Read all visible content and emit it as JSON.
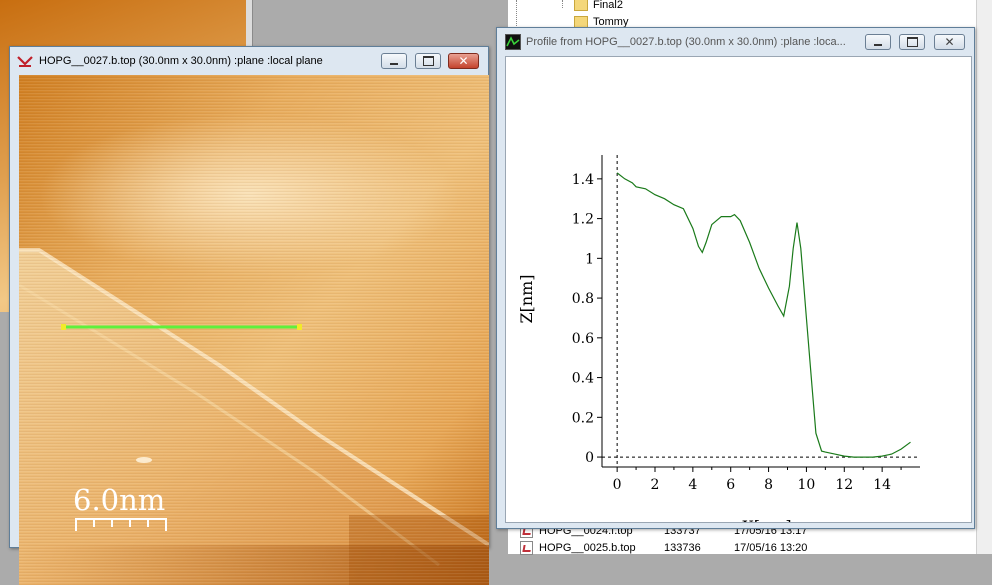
{
  "explorer": {
    "tree": [
      {
        "label": "Final2"
      },
      {
        "label": "Tommy"
      }
    ],
    "files": [
      {
        "name": "HOPG__0024.f.top",
        "size": "133737",
        "date": "17/05/16 13:17"
      },
      {
        "name": "HOPG__0025.b.top",
        "size": "133736",
        "date": "17/05/16 13:20"
      }
    ]
  },
  "image_window": {
    "title": "HOPG__0027.b.top (30.0nm x 30.0nm) :plane :local plane",
    "scale_bar_label": "6.0nm",
    "close_glyph": "✕"
  },
  "profile_window": {
    "title": "Profile from HOPG__0027.b.top (30.0nm x 30.0nm) :plane :loca...",
    "close_glyph": "✕"
  },
  "colors": {
    "profile_line": "#1a7a1a",
    "scan_line": "#5ef03c",
    "scan_endpoint": "#f2ea2a",
    "title_bar": "#dde7f1",
    "close_button": "#c4432d"
  },
  "chart_data": {
    "type": "line",
    "title": "",
    "xlabel": "X[nm]",
    "ylabel": "Z[nm]",
    "xlim": [
      -0.8,
      16.0
    ],
    "ylim": [
      -0.05,
      1.52
    ],
    "xticks": [
      0,
      2,
      4,
      6,
      8,
      10,
      12,
      14
    ],
    "yticks": [
      0,
      0.2,
      0.4,
      0.6,
      0.8,
      1,
      1.2,
      1.4
    ],
    "ytick_labels": [
      "0",
      "0.2",
      "0.4",
      "0.6",
      "0.8",
      "1",
      "1.2",
      "1.4"
    ],
    "grid": false,
    "reference_lines": {
      "x0_dashed": true,
      "y0_dashed": true
    },
    "series": [
      {
        "x": [
          0,
          0.4,
          0.8,
          1.0,
          1.5,
          2.0,
          2.5,
          3.0,
          3.5,
          4.0,
          4.3,
          4.5,
          4.7,
          5.0,
          5.5,
          6.0,
          6.2,
          6.5,
          7.0,
          7.5,
          8.0,
          8.5,
          8.8,
          9.1,
          9.3,
          9.5,
          9.7,
          10.0,
          10.3,
          10.5,
          10.8,
          11.0,
          11.5,
          12.0,
          12.5,
          13.0,
          13.5,
          14.0,
          14.5,
          15.0,
          15.5
        ],
        "y": [
          1.43,
          1.4,
          1.38,
          1.36,
          1.35,
          1.32,
          1.3,
          1.27,
          1.25,
          1.15,
          1.06,
          1.03,
          1.08,
          1.17,
          1.21,
          1.21,
          1.22,
          1.19,
          1.08,
          0.95,
          0.85,
          0.76,
          0.71,
          0.86,
          1.05,
          1.18,
          1.05,
          0.7,
          0.35,
          0.12,
          0.03,
          0.025,
          0.015,
          0.005,
          0.0,
          0.0,
          0.0,
          0.005,
          0.015,
          0.04,
          0.075
        ]
      }
    ]
  }
}
